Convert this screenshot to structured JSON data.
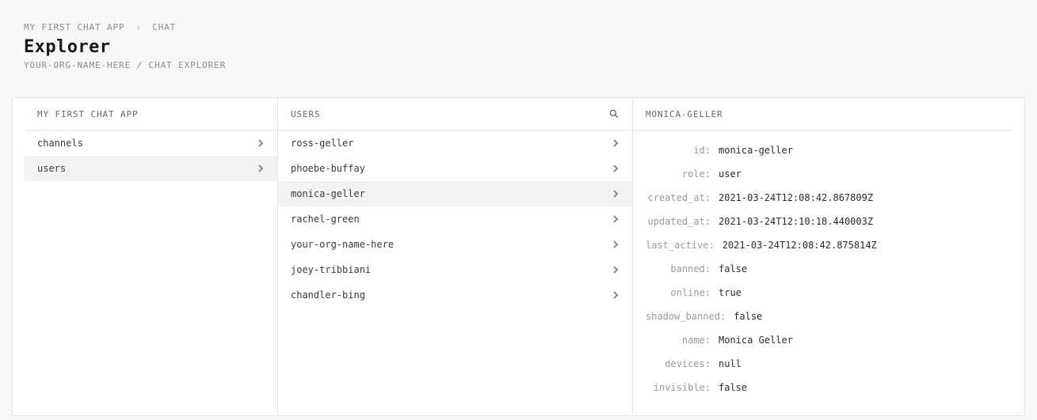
{
  "breadcrumb": {
    "app": "MY FIRST CHAT APP",
    "section": "CHAT"
  },
  "title": "Explorer",
  "subtitle": {
    "org": "YOUR-ORG-NAME-HERE",
    "sep": "/",
    "page": "CHAT EXPLORER"
  },
  "nav": {
    "header": "MY FIRST CHAT APP",
    "items": [
      {
        "label": "channels",
        "selected": false
      },
      {
        "label": "users",
        "selected": true
      }
    ]
  },
  "users": {
    "header": "USERS",
    "items": [
      {
        "label": "ross-geller",
        "selected": false
      },
      {
        "label": "phoebe-buffay",
        "selected": false
      },
      {
        "label": "monica-geller",
        "selected": true
      },
      {
        "label": "rachel-green",
        "selected": false
      },
      {
        "label": "your-org-name-here",
        "selected": false
      },
      {
        "label": "joey-tribbiani",
        "selected": false
      },
      {
        "label": "chandler-bing",
        "selected": false
      }
    ]
  },
  "detail": {
    "header": "MONICA-GELLER",
    "fields": [
      {
        "key": "id:",
        "value": "monica-geller"
      },
      {
        "key": "role:",
        "value": "user"
      },
      {
        "key": "created_at:",
        "value": "2021-03-24T12:08:42.867809Z"
      },
      {
        "key": "updated_at:",
        "value": "2021-03-24T12:10:18.440003Z"
      },
      {
        "key": "last_active:",
        "value": "2021-03-24T12:08:42.875814Z"
      },
      {
        "key": "banned:",
        "value": "false"
      },
      {
        "key": "online:",
        "value": "true"
      },
      {
        "key": "shadow_banned:",
        "value": "false"
      },
      {
        "key": "name:",
        "value": "Monica Geller"
      },
      {
        "key": "devices:",
        "value": "null"
      },
      {
        "key": "invisible:",
        "value": "false"
      }
    ]
  }
}
